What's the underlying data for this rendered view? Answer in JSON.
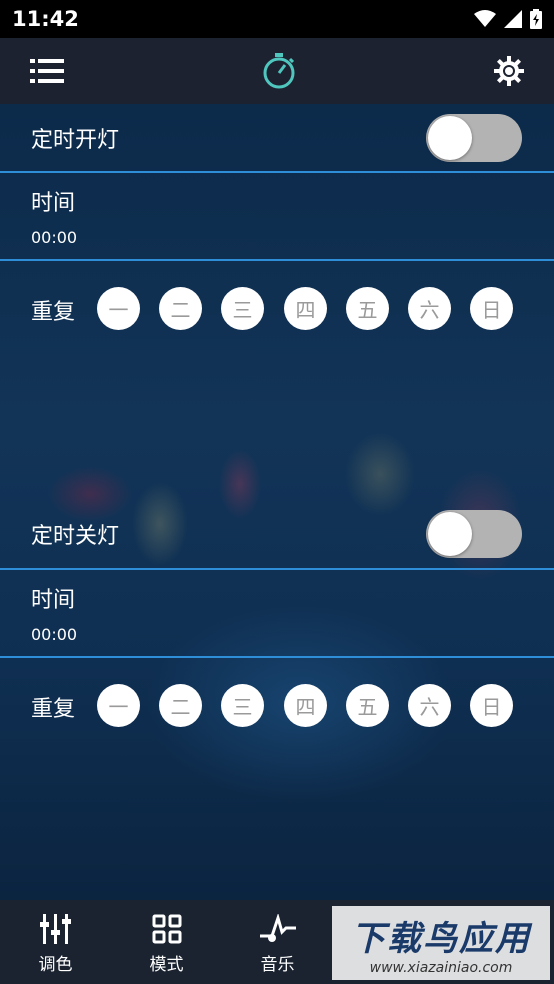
{
  "status_bar": {
    "time": "11:42"
  },
  "on_section": {
    "title": "定时开灯",
    "time_label": "时间",
    "time_value": "00:00",
    "repeat_label": "重复",
    "days": [
      "一",
      "二",
      "三",
      "四",
      "五",
      "六",
      "日"
    ],
    "enabled": false
  },
  "off_section": {
    "title": "定时关灯",
    "time_label": "时间",
    "time_value": "00:00",
    "repeat_label": "重复",
    "days": [
      "一",
      "二",
      "三",
      "四",
      "五",
      "六",
      "日"
    ],
    "enabled": false
  },
  "bottom_nav": {
    "items": [
      {
        "label": "调色",
        "icon": "sliders-icon"
      },
      {
        "label": "模式",
        "icon": "grid-icon"
      },
      {
        "label": "音乐",
        "icon": "music-note-icon"
      }
    ]
  },
  "watermark": {
    "main": "下载鸟应用",
    "sub": "www.xiazainiao.com"
  },
  "colors": {
    "accent": "#2e8fd8",
    "toolbar": "#1d2230",
    "timer_icon": "#4fc7bf"
  }
}
